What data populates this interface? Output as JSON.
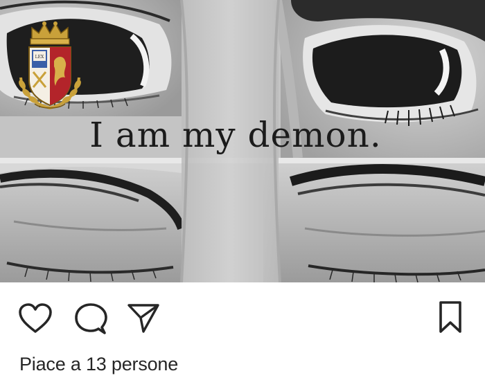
{
  "post": {
    "image": {
      "caption": "I am my demon.",
      "watermark": {
        "icon": "police-crest-icon",
        "emblem_text": "LEX"
      }
    },
    "actions": {
      "like_icon": "heart-icon",
      "comment_icon": "comment-bubble-icon",
      "share_icon": "paper-plane-icon",
      "save_icon": "bookmark-icon"
    },
    "likes_text": "Piace a 13 persone"
  },
  "colors": {
    "background": "#ffffff",
    "icon": "#262626",
    "photo_base": "#c4c4c4",
    "crest_red": "#b3242a",
    "crest_gold": "#c9a13a",
    "crest_blue": "#3a5fa8"
  }
}
